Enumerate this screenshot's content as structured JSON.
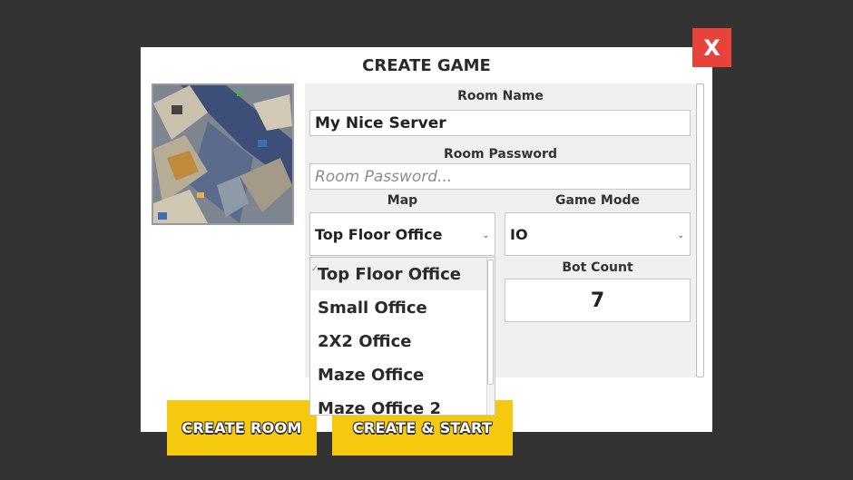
{
  "dialog": {
    "title": "CREATE GAME",
    "close_label": "X"
  },
  "form": {
    "room_name_label": "Room Name",
    "room_name_value": "My Nice Server",
    "room_password_label": "Room Password",
    "room_password_placeholder": "Room Password...",
    "map_label": "Map",
    "map_selected": "Top Floor Office",
    "game_mode_label": "Game Mode",
    "game_mode_selected": "IO",
    "bot_count_label": "Bot Count",
    "bot_count_value": "7"
  },
  "map_dropdown": {
    "options": [
      "Top Floor Office",
      "Small Office",
      "2X2 Office",
      "Maze Office",
      "Maze Office 2"
    ]
  },
  "buttons": {
    "create_room": "CREATE ROOM",
    "create_start": "CREATE & START"
  },
  "colors": {
    "background": "#333333",
    "close": "#e8433a",
    "button": "#f7c90e"
  }
}
